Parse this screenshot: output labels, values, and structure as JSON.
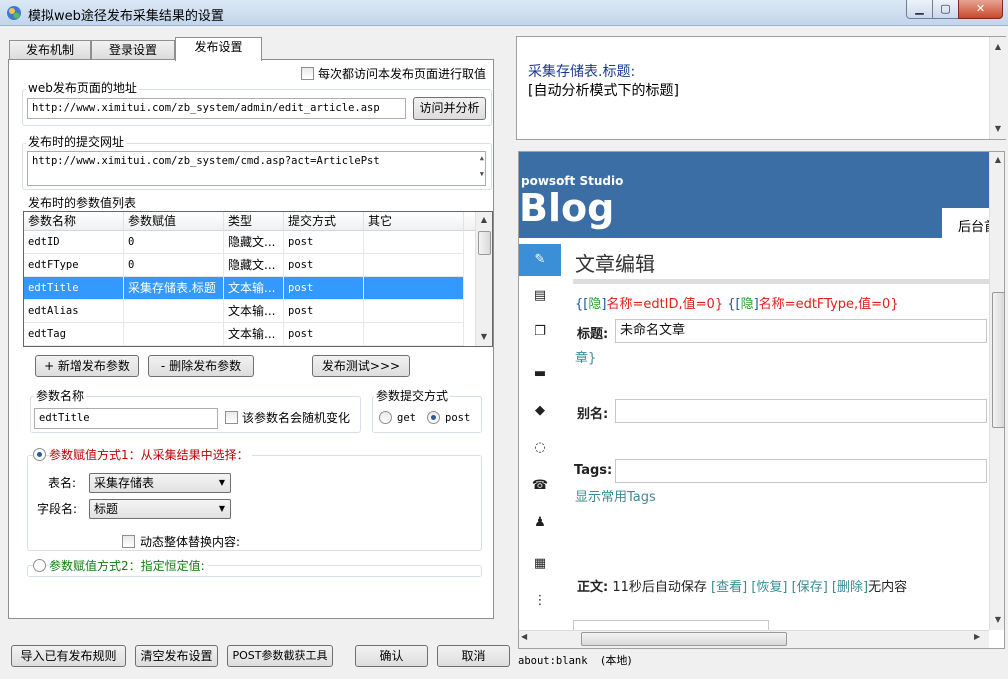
{
  "window": {
    "title": "模拟web途径发布采集结果的设置",
    "min_label": "▁",
    "max_label": "▢",
    "close_label": "✕"
  },
  "tabs": [
    {
      "label": "发布机制"
    },
    {
      "label": "登录设置"
    },
    {
      "label": "发布设置"
    }
  ],
  "publish": {
    "revisit_checkbox_label": "每次都访问本发布页面进行取值",
    "page_url_group": "web发布页面的地址",
    "page_url_value": "http://www.ximitui.com/zb_system/admin/edit_article.asp",
    "visit_analyze_button": "访问并分析",
    "submit_url_group": "发布时的提交网址",
    "submit_url_value": "http://www.ximitui.com/zb_system/cmd.asp?act=ArticlePst",
    "params_group": "发布时的参数值列表",
    "table_headers": [
      "参数名称",
      "参数赋值",
      "类型",
      "提交方式",
      "其它"
    ],
    "table_rows": [
      {
        "name": "edtID",
        "value": "0",
        "type": "隐藏文...",
        "method": "post",
        "other": ""
      },
      {
        "name": "edtFType",
        "value": "0",
        "type": "隐藏文...",
        "method": "post",
        "other": ""
      },
      {
        "name": "edtTitle",
        "value": "采集存储表.标题",
        "type": "文本输...",
        "method": "post",
        "other": ""
      },
      {
        "name": "edtAlias",
        "value": "",
        "type": "文本输...",
        "method": "post",
        "other": ""
      },
      {
        "name": "edtTag",
        "value": "",
        "type": "文本输...",
        "method": "post",
        "other": ""
      }
    ],
    "add_param_button": "+ 新增发布参数",
    "delete_param_button": "- 删除发布参数",
    "test_button": "发布测试>>>",
    "param_name_group": "参数名称",
    "param_name_value": "edtTitle",
    "random_change_label": "该参数名会随机变化",
    "submit_method_group": "参数提交方式",
    "method_get": "get",
    "method_post": "post",
    "mode1_label": "参数赋值方式1：从采集结果中选择：",
    "table_name_label": "表名:",
    "table_name_value": "采集存储表",
    "field_name_label": "字段名:",
    "field_name_value": "标题",
    "dynamic_replace_label": "动态整体替换内容:",
    "mode2_label": "参数赋值方式2：指定恒定值:"
  },
  "footer": {
    "import_button": "导入已有发布规则",
    "clear_button": "清空发布设置",
    "post_tool_button": "POST参数截获工具",
    "ok_button": "确认",
    "cancel_button": "取消"
  },
  "preview": {
    "line1": "采集存储表.标题:",
    "line2": "[自动分析模式下的标题]"
  },
  "browser": {
    "brand_sub": "powsoft Studio",
    "brand_big": "Blog",
    "admin_tab": "后台首",
    "page_heading": "文章编辑",
    "hidden_fields": {
      "b1": "{[",
      "h1": "隐",
      "b2": "]",
      "n1": "名称=edtID,",
      "v1": "值=0}",
      "b3": " {[",
      "h2": "隐",
      "b4": "]",
      "n2": "名称=edtFType,",
      "v2": "值=0}"
    },
    "title_label": "标题:",
    "title_value": "未命名文章",
    "title_suffix": "章}",
    "alias_label": "别名:",
    "tags_label": "Tags:",
    "common_tags_link": "显示常用Tags",
    "body_label": "正文:",
    "autosave": "11秒后自动保存",
    "view_link": "[查看]",
    "restore_link": "[恢复]",
    "save_link": "[保存]",
    "delete_link": "[删除]",
    "no_content": "无内容"
  },
  "status": {
    "url": "about:blank",
    "zone": "(本地)"
  },
  "colors": {
    "mode1_red": "#c00000",
    "mode2_green": "#0f7d0f",
    "selection_blue": "#3399ff",
    "blog_blue": "#3a6ea5"
  }
}
